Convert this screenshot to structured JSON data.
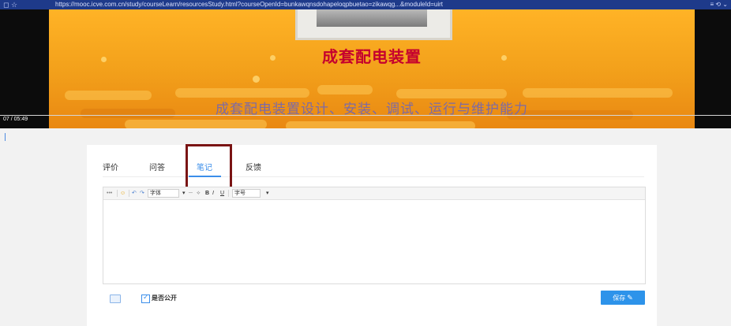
{
  "browser": {
    "nav_icons": "◻ ☆",
    "url": "https://mooc.icve.com.cn/study/courseLearn/resourcesStudy.html?courseOpenId=bunkawqnsdohapeloqpbuetao=zikawqg...&moduleId=uirt",
    "tools": "≡ ⟲ ⌄"
  },
  "video": {
    "title": "成套配电装置",
    "subtitle": "成套配电装置设计、安装、调试、运行与维护能力",
    "time": "07 / 05:49"
  },
  "tabs": [
    {
      "label": "评价"
    },
    {
      "label": "问答"
    },
    {
      "label": "笔记"
    },
    {
      "label": "反馈"
    }
  ],
  "active_tab": "笔记",
  "editor": {
    "font_select": "字体",
    "size_select": "字号",
    "bold": "B",
    "italic": "I",
    "underline": "U",
    "content": ""
  },
  "footer": {
    "public_label": "是否公开",
    "public_checked": true,
    "save_label": "保存"
  },
  "colors": {
    "accent": "#3b8eea",
    "highlight_box": "#7a1414",
    "video_title": "#c5002e"
  }
}
